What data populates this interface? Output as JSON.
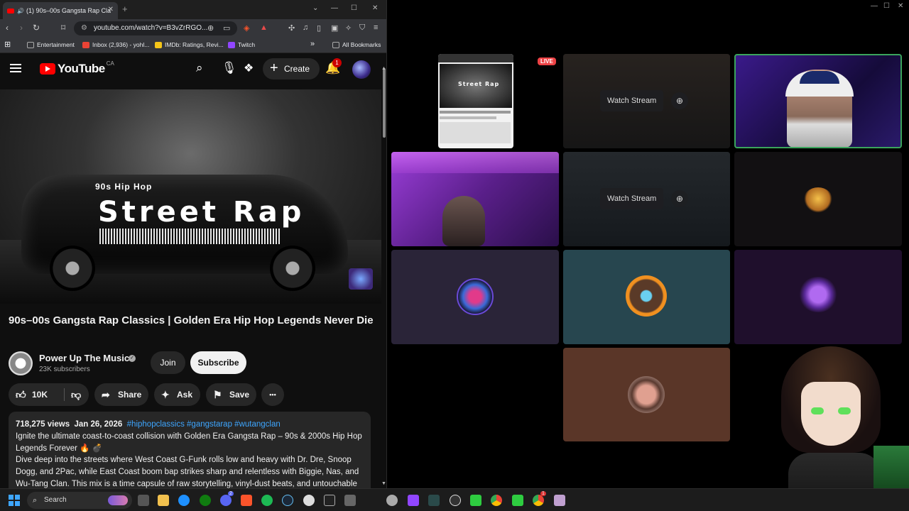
{
  "browser": {
    "tab_title": "(1) 90s–00s Gangsta Rap Cla",
    "url": "youtube.com/watch?v=B3vZrRGO...",
    "bookmarks": [
      {
        "label": "Entertainment",
        "color": "#888888"
      },
      {
        "label": "Inbox (2,936) - yohl...",
        "color": "#ea4335"
      },
      {
        "label": "IMDb: Ratings, Revi...",
        "color": "#f5c518"
      },
      {
        "label": "Twitch",
        "color": "#9146ff"
      }
    ],
    "all_bookmarks": "All Bookmarks",
    "more_bookmarks": "»"
  },
  "youtube": {
    "logo_text": "YouTube",
    "region": "CA",
    "create_label": "Create",
    "notifications_count": "1",
    "thumbnail": {
      "subtitle": "90s Hip Hop",
      "title": "Street Rap"
    },
    "video_title": "90s–00s Gangsta Rap Classics | Golden Era Hip Hop Legends Never Die",
    "channel_name": "Power Up The Music",
    "subscribers": "23K subscribers",
    "join_label": "Join",
    "subscribe_label": "Subscribe",
    "likes": "10K",
    "share_label": "Share",
    "ask_label": "Ask",
    "save_label": "Save",
    "more_label": "•••",
    "views": "718,275 views",
    "date": "Jan 26, 2026",
    "hashtags": "#hiphopclassics #gangstarap #wutangclan",
    "description_1": "Ignite the ultimate coast-to-coast collision with Golden Era Gangsta Rap – 90s & 2000s Hip Hop Legends Forever 🔥 💣",
    "description_2": "Dive deep into the streets where West Coast G-Funk rolls low and heavy with Dr. Dre, Snoop Dogg, and 2Pac, while East Coast boom bap strikes sharp and relentless with Biggie, Nas, and Wu-Tang Clan. This mix is a time capsule of raw storytelling, vinyl-dust beats, and untouchable"
  },
  "discord": {
    "live_badge": "LIVE",
    "watch_stream_label": "Watch Stream",
    "tile_colors": {
      "purple_dark": "#2a2438",
      "teal": "#27464f",
      "deep_purple": "#1f0f2c",
      "brown": "#5a3628",
      "dark": "#121012",
      "speaking_border": "#3ba55c"
    }
  },
  "taskbar": {
    "search_label": "Search",
    "discord_badge": "2",
    "chrome_badge": "1"
  }
}
